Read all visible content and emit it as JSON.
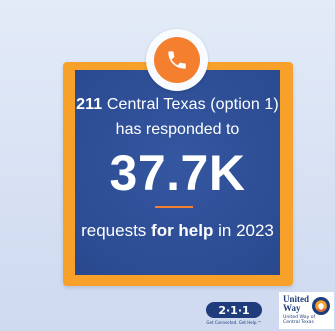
{
  "card": {
    "line1_bold": "211",
    "line1_rest": "Central Texas (option 1)",
    "line2": "has responded to",
    "stat": "37.7K",
    "line3_prefix": "requests",
    "line3_strong": "for help",
    "line3_suffix": "in 2023"
  },
  "logos": {
    "211": {
      "mark": "2·1·1",
      "tagline": "Get Connected. Get Help.™"
    },
    "united_way": {
      "line1": "United",
      "line2": "Way",
      "org1": "United Way of",
      "org2": "Central Texas"
    }
  },
  "colors": {
    "background": "#dbe4f5",
    "frame": "#f7a12a",
    "panel": "#2b4b92",
    "accent": "#f37f2f",
    "text": "#ffffff",
    "navy": "#1f3d7a"
  },
  "icons": {
    "phone": "phone-icon",
    "emblem": "united-way-emblem-icon"
  }
}
